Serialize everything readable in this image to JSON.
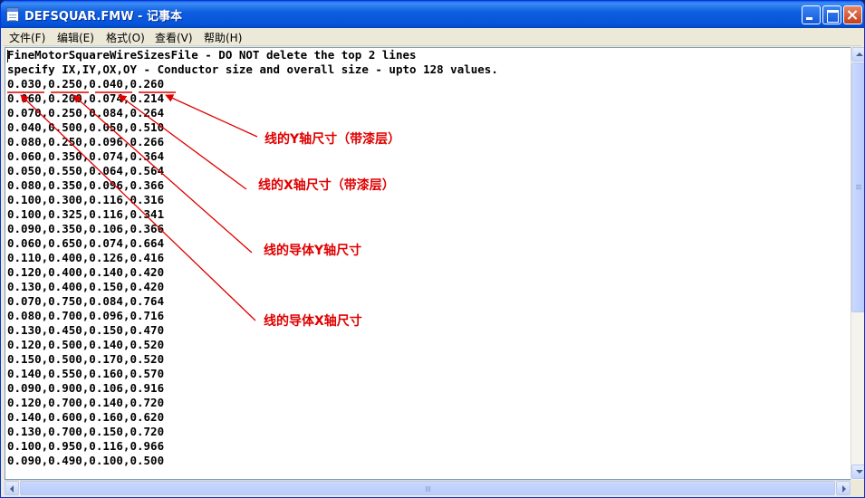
{
  "window": {
    "title": "DEFSQUAR.FMW - 记事本",
    "app_icon": "notepad-icon"
  },
  "menu": [
    {
      "label": "文件(F)"
    },
    {
      "label": "编辑(E)"
    },
    {
      "label": "格式(O)"
    },
    {
      "label": "查看(V)"
    },
    {
      "label": "帮助(H)"
    }
  ],
  "document": {
    "lines": [
      "FineMotorSquareWireSizesFile - DO NOT delete the top 2 lines",
      "specify IX,IY,OX,OY - Conductor size and overall size - upto 128 values.",
      "0.030,0.250,0.040,0.260",
      "0.060,0.200,0.074,0.214",
      "0.070,0.250,0.084,0.264",
      "0.040,0.500,0.050,0.510",
      "0.080,0.250,0.096,0.266",
      "0.060,0.350,0.074,0.364",
      "0.050,0.550,0.064,0.564",
      "0.080,0.350,0.096,0.366",
      "0.100,0.300,0.116,0.316",
      "0.100,0.325,0.116,0.341",
      "0.090,0.350,0.106,0.366",
      "0.060,0.650,0.074,0.664",
      "0.110,0.400,0.126,0.416",
      "0.120,0.400,0.140,0.420",
      "0.130,0.400,0.150,0.420",
      "0.070,0.750,0.084,0.764",
      "0.080,0.700,0.096,0.716",
      "0.130,0.450,0.150,0.470",
      "0.120,0.500,0.140,0.520",
      "0.150,0.500,0.170,0.520",
      "0.140,0.550,0.160,0.570",
      "0.090,0.900,0.106,0.916",
      "0.120,0.700,0.140,0.720",
      "0.140,0.600,0.160,0.620",
      "0.130,0.700,0.150,0.720",
      "0.100,0.950,0.116,0.966",
      "0.090,0.490,0.100,0.500"
    ]
  },
  "annotations": {
    "color": "#e00000",
    "labels": [
      {
        "text": "线的Y轴尺寸（带漆层）"
      },
      {
        "text": "线的X轴尺寸（带漆层）"
      },
      {
        "text": "线的导体Y轴尺寸"
      },
      {
        "text": "线的导体X轴尺寸"
      }
    ]
  }
}
